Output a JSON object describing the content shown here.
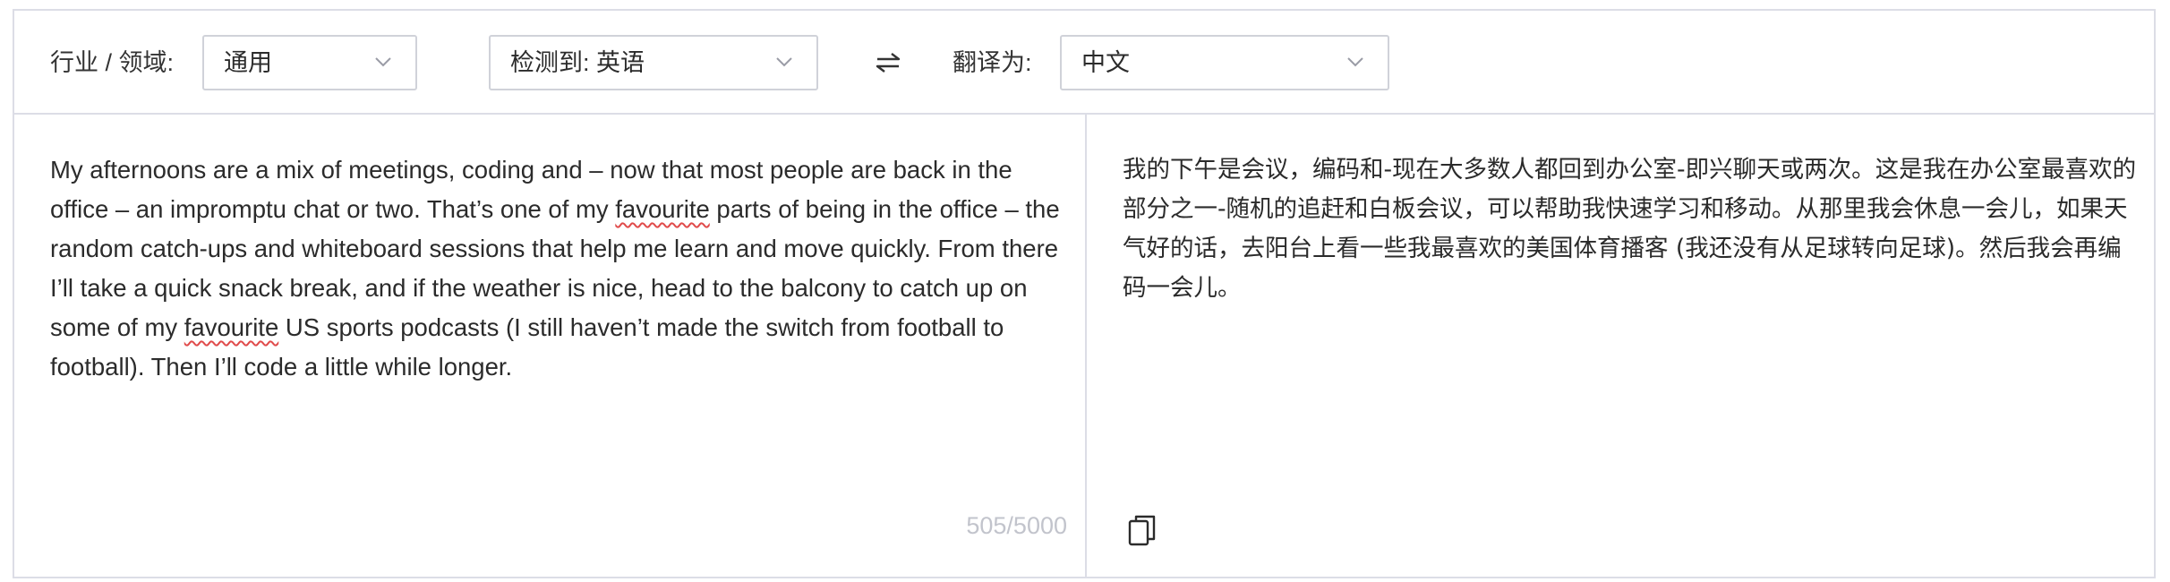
{
  "toolbar": {
    "industry_label": "行业 / 领域:",
    "industry_value": "通用",
    "detected_value": "检测到: 英语",
    "translate_to_label": "翻译为:",
    "target_value": "中文"
  },
  "source": {
    "segments": [
      "My afternoons are a mix of meetings, coding and – now that most people are back in the office – an impromptu chat or two. That’s one of my ",
      "favourite",
      " parts of being in the office – the random catch-ups and whiteboard sessions that help me learn and move quickly. From there I’ll take a quick snack break, and if the weather is nice, head to the balcony to catch up on some of my ",
      "favourite",
      " US sports podcasts (I still haven’t made the switch from football to football). Then I’ll code a little while longer."
    ],
    "char_count": "505/5000"
  },
  "target": {
    "text": "我的下午是会议，编码和-现在大多数人都回到办公室-即兴聊天或两次。这是我在办公室最喜欢的部分之一-随机的追赶和白板会议，可以帮助我快速学习和移动。从那里我会休息一会儿，如果天气好的话，去阳台上看一些我最喜欢的美国体育播客 (我还没有从足球转向足球)。然后我会再编码一会儿。"
  },
  "icons": {
    "chevron": "chevron-down-icon",
    "swap": "swap-arrows-icon",
    "copy": "copy-icon"
  }
}
